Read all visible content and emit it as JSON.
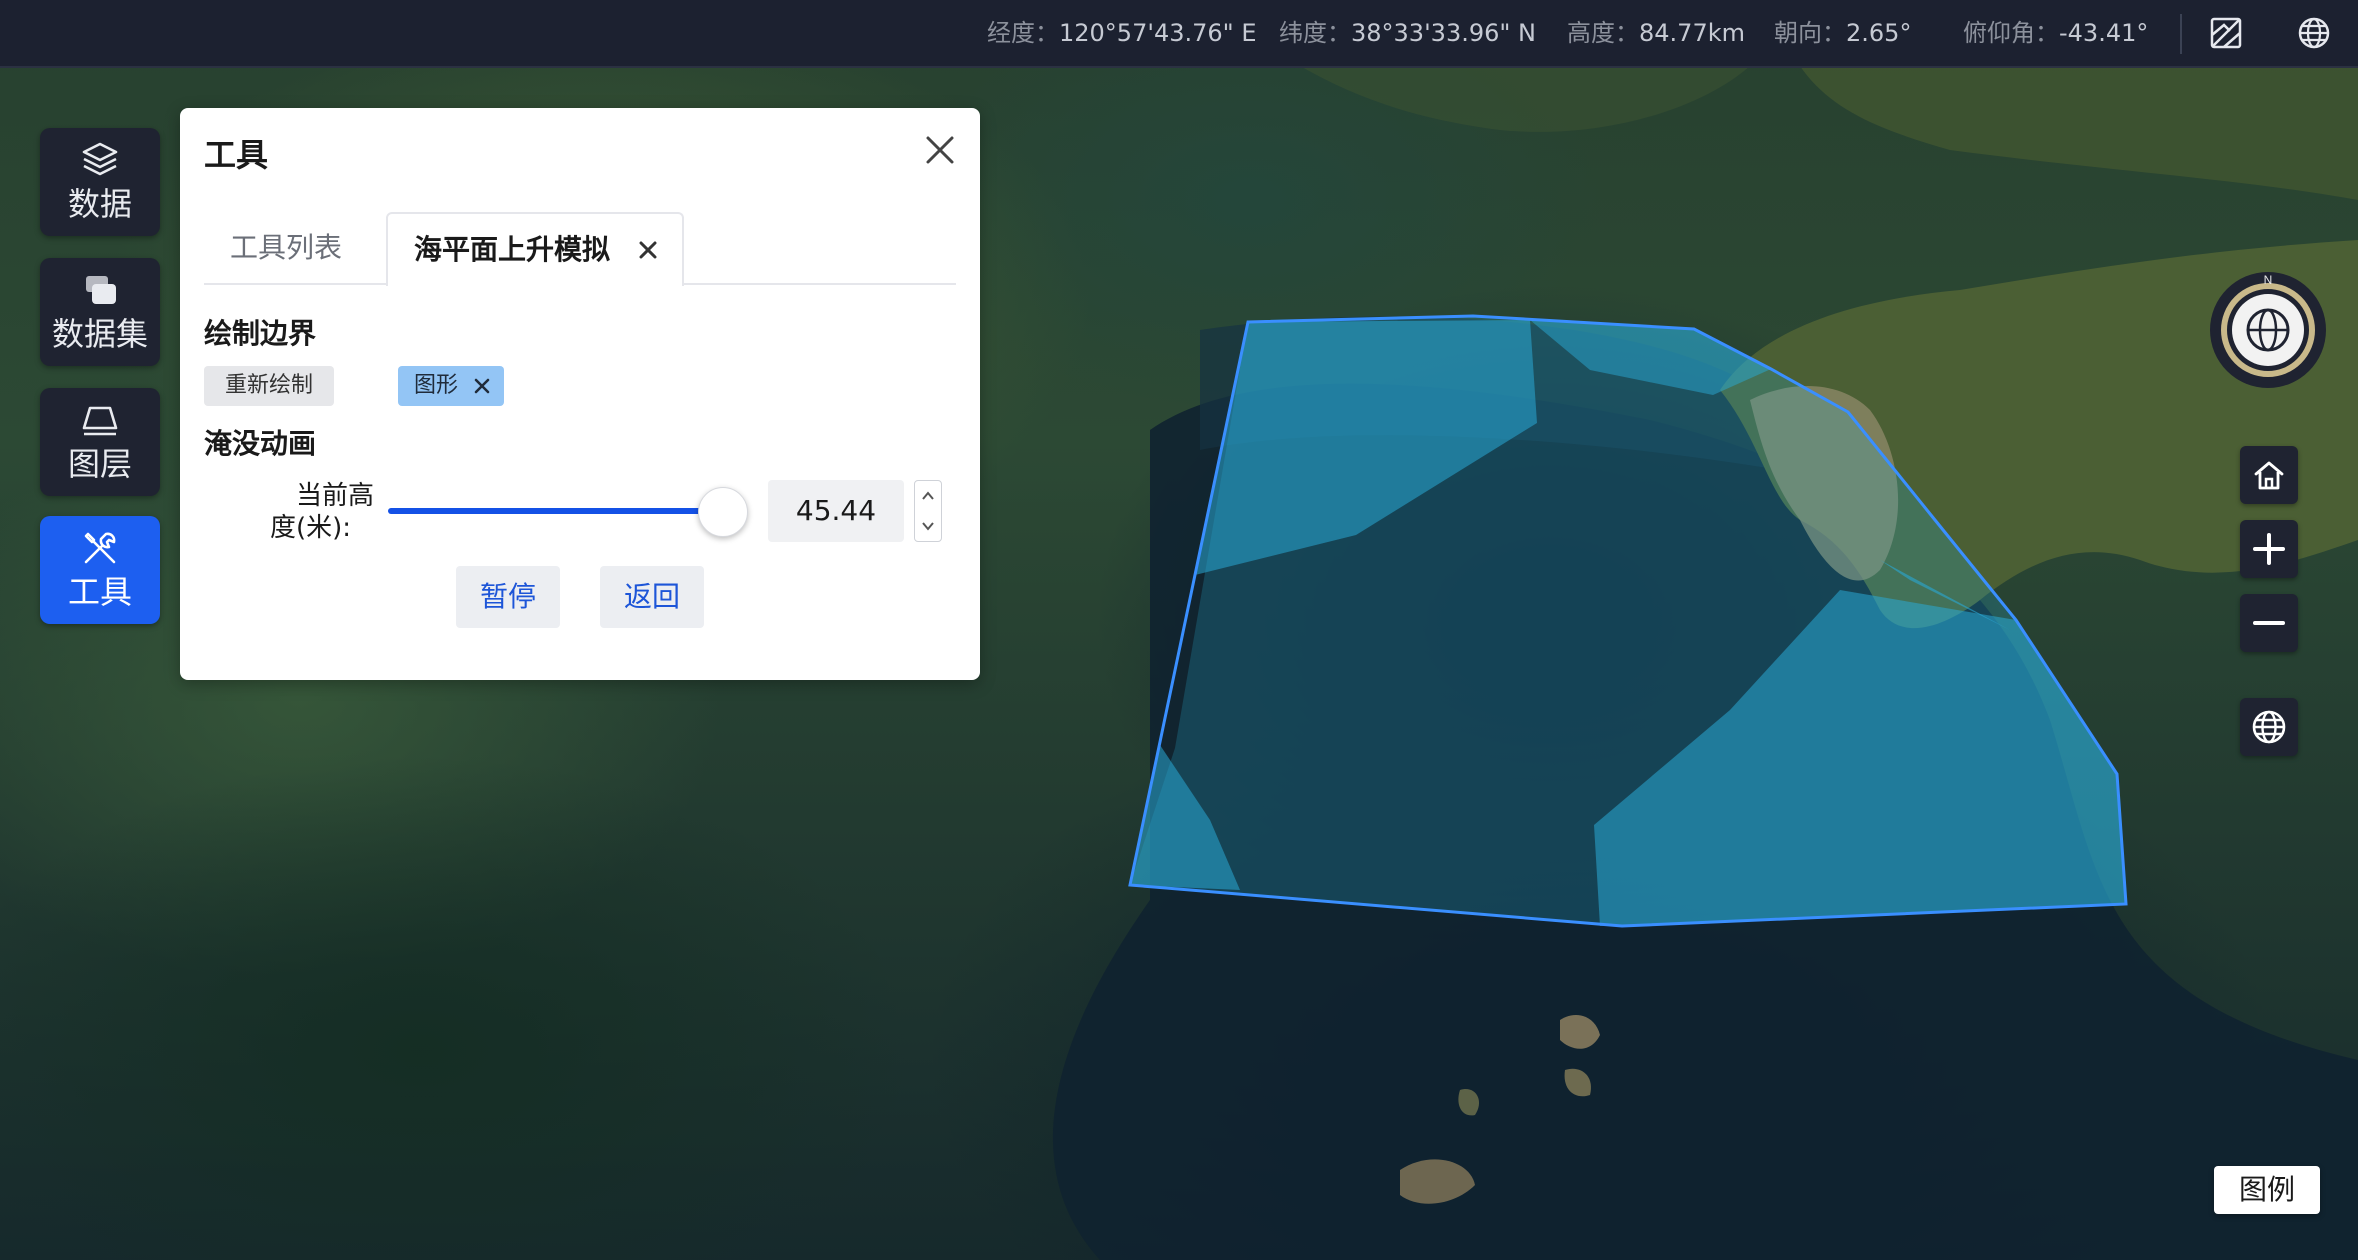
{
  "statusbar": {
    "longitude": {
      "label": "经度",
      "value": "120°57'43.76\" E"
    },
    "latitude": {
      "label": "纬度",
      "value": "38°33'33.96\" N"
    },
    "altitude": {
      "label": "高度",
      "value": "84.77km"
    },
    "heading": {
      "label": "朝向",
      "value": "2.65°"
    },
    "pitch": {
      "label": "俯仰角",
      "value": "-43.41°"
    },
    "icons": [
      "map-off-icon",
      "globe-icon"
    ]
  },
  "nav": {
    "items": [
      {
        "label": "数据",
        "icon": "layers-icon",
        "active": false
      },
      {
        "label": "数据集",
        "icon": "dataset-icon",
        "active": false
      },
      {
        "label": "图层",
        "icon": "layer-plane-icon",
        "active": false
      },
      {
        "label": "工具",
        "icon": "tools-icon",
        "active": true
      }
    ]
  },
  "panel": {
    "title": "工具",
    "tabs": [
      {
        "label": "工具列表",
        "active": false
      },
      {
        "label": "海平面上升模拟",
        "active": true,
        "closable": true
      }
    ],
    "draw_boundary": {
      "title": "绘制边界",
      "redraw_button": "重新绘制",
      "shape_tag": "图形"
    },
    "flood_animation": {
      "title": "淹没动画",
      "height_label_line1": "当前高",
      "height_label_line2": "度(米):",
      "current_height": "45.44",
      "slider_fraction": 1.0,
      "pause_button": "暂停",
      "back_button": "返回"
    }
  },
  "map": {
    "compass_letter": "N",
    "controls": [
      "home-icon",
      "zoom-in-icon",
      "zoom-out-icon",
      "globe-icon"
    ],
    "flood_polygon_color": "#29a9d6",
    "flood_outline_color": "#3a8fff",
    "legend_button": "图例"
  },
  "colors": {
    "accent": "#1d5ff0",
    "topbar": "#1c2130",
    "nav_bg": "#1f2331"
  }
}
